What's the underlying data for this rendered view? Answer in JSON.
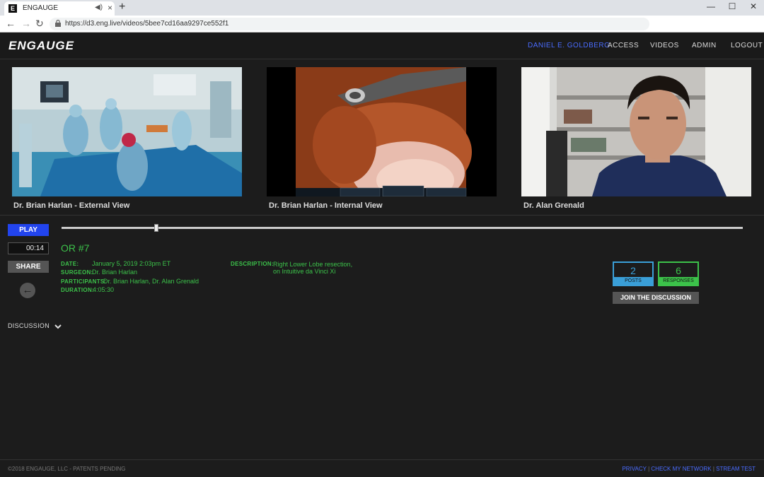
{
  "browser": {
    "tab_title": "ENGAUGE",
    "favicon_letter": "E",
    "url": "https://d3.eng.live/videos/5bee7cd16aa9297ce552f1"
  },
  "nav": {
    "logo": "ENGAUGE",
    "user": "DANIEL E. GOLDBERG",
    "links": [
      "ACCESS",
      "VIDEOS",
      "ADMIN",
      "LOGOUT"
    ]
  },
  "videos": [
    {
      "label": "Dr. Brian Harlan - External View"
    },
    {
      "label": "Dr. Brian Harlan - Internal View"
    },
    {
      "label": "Dr. Alan Grenald"
    }
  ],
  "controls": {
    "play_label": "PLAY",
    "time": "00:14",
    "share_label": "SHARE",
    "progress": 0.139
  },
  "info": {
    "title": "OR #7",
    "date_label": "DATE:",
    "date_value": "January 5, 2019  2:03pm ET",
    "surgeon_label": "SURGEON:",
    "surgeon_value": "Dr. Brian Harlan",
    "participants_label": "PARTICIPANTS:",
    "participants_value": "Dr. Brian Harlan, Dr. Alan Grenald",
    "duration_label": "DURATION:",
    "duration_value": "4:05:30",
    "description_label": "DESCRIPTION:",
    "description_line1": "Right Lower Lobe resection,",
    "description_line2": "on Intuitive da Vinci Xi"
  },
  "stats": {
    "posts_count": "2",
    "posts_label": "POSTS",
    "responses_count": "6",
    "responses_label": "RESPONSES",
    "join_label": "JOIN THE DISCUSSION"
  },
  "discussion_label": "DISCUSSION",
  "footer": {
    "copyright": "©2018 ENGAUGE, LLC - PATENTS PENDING",
    "privacy": "PRIVACY",
    "network": "CHECK MY NETWORK",
    "stream": "STREAM TEST"
  },
  "colors": {
    "accent_blue": "#2244ee",
    "link_blue": "#4a6cff",
    "accent_green": "#3cc24a",
    "posts_border": "#3a9fd8",
    "responses_border": "#3cc24a"
  }
}
